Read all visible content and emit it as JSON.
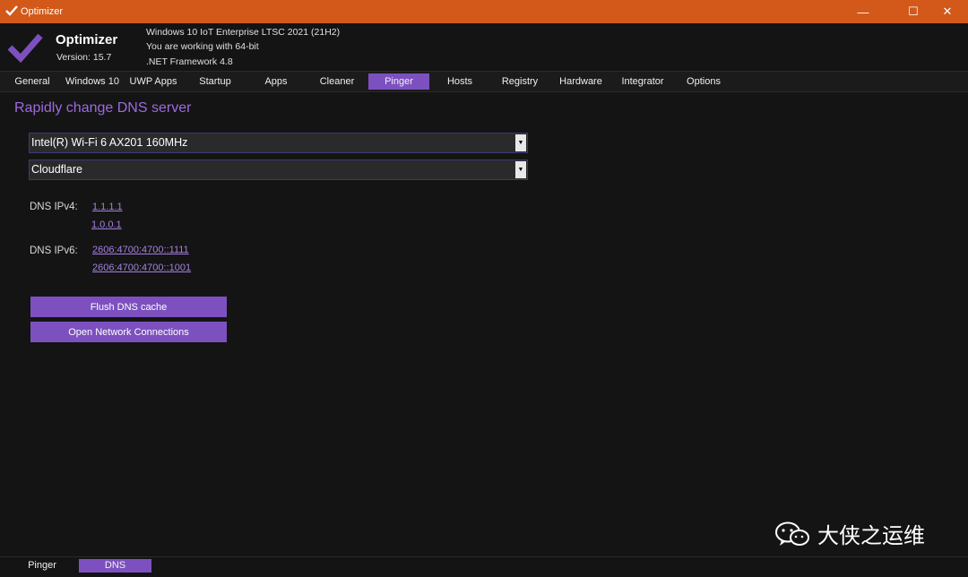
{
  "window": {
    "title": "Optimizer",
    "controls": {
      "minimize": "—",
      "maximize": "☐",
      "close": "✕"
    }
  },
  "header": {
    "app_name": "Optimizer",
    "version": "Version: 15.7",
    "system_info": [
      "Windows 10 IoT Enterprise LTSC 2021 (21H2)",
      "You are working with 64-bit",
      ".NET Framework 4.8"
    ]
  },
  "tabs": [
    {
      "label": "General"
    },
    {
      "label": "Windows 10"
    },
    {
      "label": "UWP Apps"
    },
    {
      "label": "Startup"
    },
    {
      "label": "Apps"
    },
    {
      "label": "Cleaner"
    },
    {
      "label": "Pinger",
      "active": true
    },
    {
      "label": "Hosts"
    },
    {
      "label": "Registry"
    },
    {
      "label": "Hardware"
    },
    {
      "label": "Integrator"
    },
    {
      "label": "Options"
    }
  ],
  "main": {
    "heading": "Rapidly change DNS server",
    "adapter_select": {
      "value": "Intel(R) Wi-Fi 6 AX201 160MHz"
    },
    "dns_provider_select": {
      "value": "Cloudflare"
    },
    "ipv4": {
      "label": "DNS IPv4:",
      "primary": "1.1.1.1",
      "secondary": "1.0.0.1"
    },
    "ipv6": {
      "label": "DNS IPv6:",
      "primary": "2606:4700:4700::1111",
      "secondary": "2606:4700:4700::1001"
    },
    "flush_button": "Flush DNS cache",
    "open_connections_button": "Open Network Connections"
  },
  "watermark": {
    "text": "大侠之运维",
    "icon": "wechat-icon"
  },
  "bottom_tabs": [
    {
      "label": "Pinger"
    },
    {
      "label": "DNS",
      "active": true
    }
  ],
  "colors": {
    "titlebar": "#d2591a",
    "accent": "#7d50c0",
    "heading": "#9d6ae0",
    "background": "#141414"
  }
}
